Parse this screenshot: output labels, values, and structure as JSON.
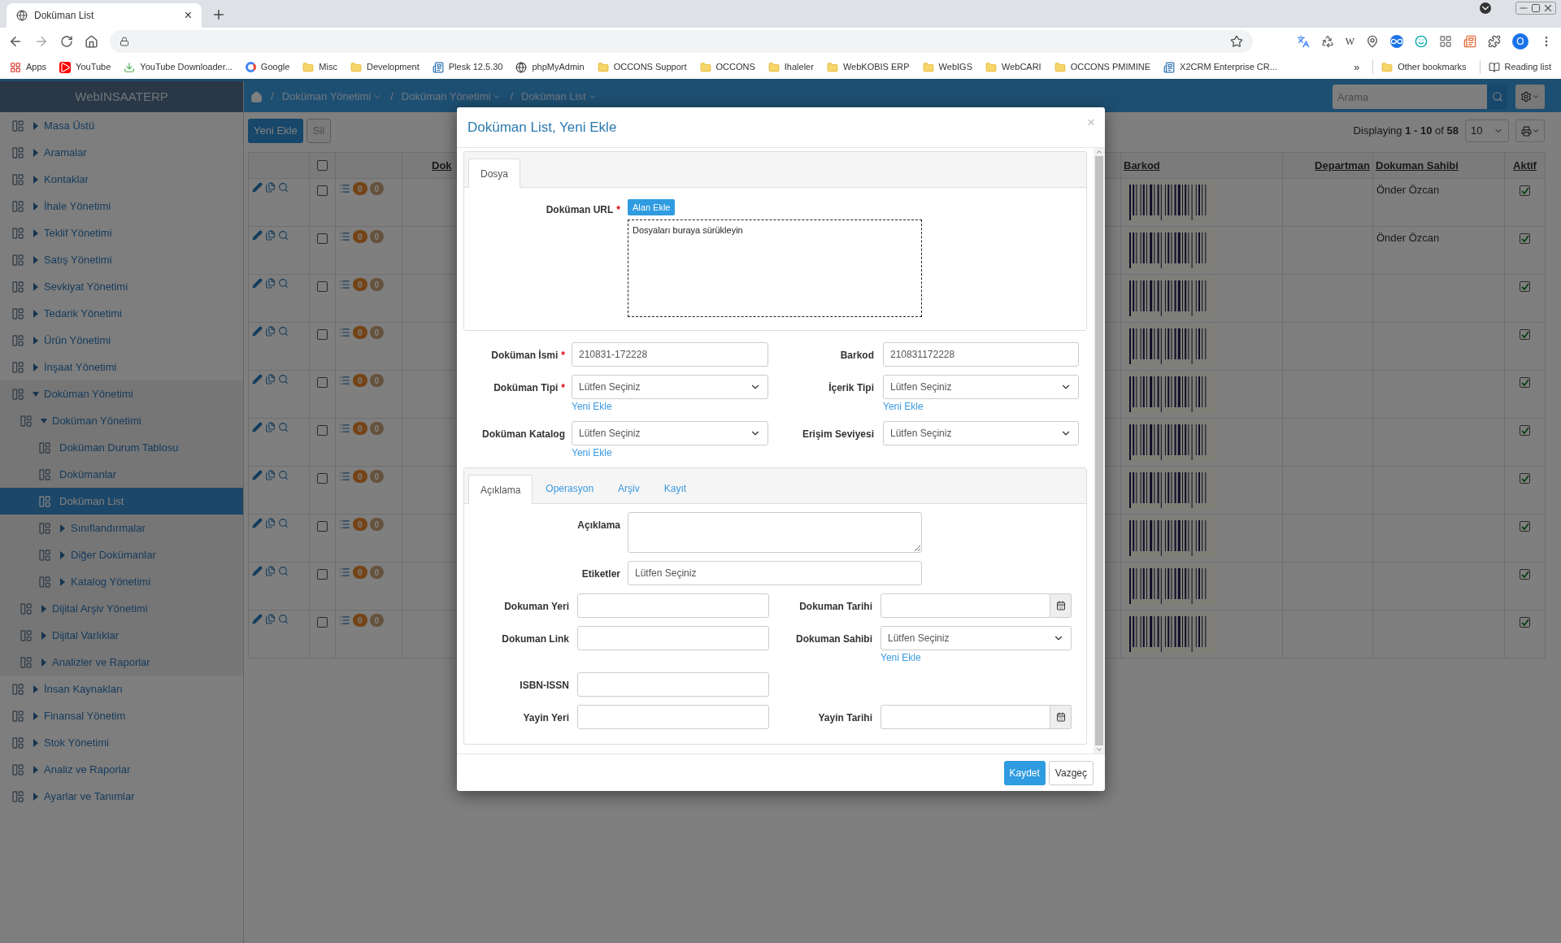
{
  "browser": {
    "tab": {
      "title": "Doküman List",
      "close": "×"
    },
    "extension_letter": "W",
    "profile": "O",
    "bookmarks": [
      {
        "label": "Apps",
        "kind": "apps"
      },
      {
        "label": "YouTube",
        "kind": "video"
      },
      {
        "label": "YouTube Downloader...",
        "kind": "download"
      },
      {
        "label": "Google",
        "kind": "google"
      },
      {
        "label": "Misc",
        "kind": "folder"
      },
      {
        "label": "Development",
        "kind": "folder"
      },
      {
        "label": "Plesk 12.5.30",
        "kind": "site"
      },
      {
        "label": "phpMyAdmin",
        "kind": "globe"
      },
      {
        "label": "OCCONS Support",
        "kind": "folder"
      },
      {
        "label": "OCCONS",
        "kind": "folder"
      },
      {
        "label": "Ihaleler",
        "kind": "folder"
      },
      {
        "label": "WebKOBIS ERP",
        "kind": "folder"
      },
      {
        "label": "WebIGS",
        "kind": "folder"
      },
      {
        "label": "WebCARI",
        "kind": "folder"
      },
      {
        "label": "OCCONS PMIMINE",
        "kind": "folder"
      },
      {
        "label": "X2CRM Enterprise CR...",
        "kind": "site"
      }
    ],
    "overflow": "»",
    "other_bookmarks": "Other bookmarks",
    "reading_list": "Reading list"
  },
  "app": {
    "brand": "WebINSAATERP",
    "breadcrumb": [
      {
        "label": "Doküman Yönetimi"
      },
      {
        "label": "Doküman Yönetimi"
      },
      {
        "label": "Doküman List"
      }
    ],
    "separator": "/",
    "search": {
      "placeholder": "Arama"
    }
  },
  "sidebar": {
    "items": [
      {
        "label": "Masa Üstü",
        "expanded": false,
        "selected": false
      },
      {
        "label": "Aramalar",
        "expanded": false,
        "selected": false
      },
      {
        "label": "Kontaklar",
        "expanded": false,
        "selected": false
      },
      {
        "label": "İhale Yönetimi",
        "expanded": false,
        "selected": false
      },
      {
        "label": "Teklif Yönetimi",
        "expanded": false,
        "selected": false
      },
      {
        "label": "Satış Yönetimi",
        "expanded": false,
        "selected": false
      },
      {
        "label": "Sevkiyat Yönetimi",
        "expanded": false,
        "selected": false
      },
      {
        "label": "Tedarik Yönetimi",
        "expanded": false,
        "selected": false
      },
      {
        "label": "Ürün Yönetimi",
        "expanded": false,
        "selected": false
      },
      {
        "label": "İnşaat Yönetimi",
        "expanded": false,
        "selected": false
      },
      {
        "label": "Doküman Yönetimi",
        "expanded": true,
        "selected": false,
        "children": [
          {
            "label": "Doküman Yönetimi",
            "expanded": true,
            "selected": false,
            "children": [
              {
                "label": "Doküman Durum Tablosu",
                "selected": false
              },
              {
                "label": "Dokümanlar",
                "selected": false
              },
              {
                "label": "Doküman List",
                "selected": true
              },
              {
                "label": "Sınıflandırmalar",
                "expanded": false,
                "selected": false
              },
              {
                "label": "Diğer Dokümanlar",
                "expanded": false,
                "selected": false
              },
              {
                "label": "Katalog Yönetimi",
                "expanded": false,
                "selected": false
              }
            ]
          },
          {
            "label": "Dijital Arşiv Yönetimi",
            "expanded": false,
            "selected": false
          },
          {
            "label": "Dijital Varlıklar",
            "expanded": false,
            "selected": false
          },
          {
            "label": "Analizler ve Raporlar",
            "expanded": false,
            "selected": false
          }
        ]
      },
      {
        "label": "İnsan Kaynakları",
        "expanded": false,
        "selected": false
      },
      {
        "label": "Finansal Yönetim",
        "expanded": false,
        "selected": false
      },
      {
        "label": "Stok Yönetimi",
        "expanded": false,
        "selected": false
      },
      {
        "label": "Analiz ve Raporlar",
        "expanded": false,
        "selected": false
      },
      {
        "label": "Ayarlar ve Tanımlar",
        "expanded": false,
        "selected": false
      }
    ]
  },
  "toolbar": {
    "buttons": [
      {
        "label": "Yeni Ekle",
        "kind": "primary"
      },
      {
        "label": "Sil",
        "kind": "disabled"
      }
    ],
    "paging": "Displaying **1 - 10** of **58**",
    "page_size": "10"
  },
  "table": {
    "select_all": {
      "checked": false
    },
    "columns": [
      {
        "label": "Dok"
      },
      {
        "label": "Barkod"
      },
      {
        "label": "Departman"
      },
      {
        "label": "Dokuman Sahibi"
      },
      {
        "label": "Aktif"
      }
    ],
    "rows": [
      {
        "checked": false,
        "count_1": "0",
        "count_2": "0",
        "owner": "Önder Özcan",
        "aktif": true
      },
      {
        "checked": false,
        "count_1": "0",
        "count_2": "0",
        "owner": "Önder Özcan",
        "aktif": true
      },
      {
        "checked": false,
        "count_1": "0",
        "count_2": "0",
        "aktif": true
      },
      {
        "checked": false,
        "count_1": "0",
        "count_2": "0",
        "aktif": true
      },
      {
        "checked": false,
        "count_1": "0",
        "count_2": "0",
        "aktif": true
      },
      {
        "checked": false,
        "count_1": "0",
        "count_2": "0",
        "aktif": true
      },
      {
        "checked": false,
        "count_1": "0",
        "count_2": "0",
        "aktif": true
      },
      {
        "checked": false,
        "count_1": "0",
        "count_2": "0",
        "aktif": true
      },
      {
        "checked": false,
        "count_1": "0",
        "count_2": "0",
        "aktif": true
      },
      {
        "checked": false,
        "count_1": "0",
        "count_2": "0",
        "aktif": true
      }
    ]
  },
  "modal": {
    "title": "Doküman List, Yeni Ekle",
    "close": "×",
    "file_panel": {
      "tabs": [
        {
          "label": "Dosya",
          "selected": true
        }
      ],
      "url_field": {
        "label": "Doküman URL",
        "required_mark": "*",
        "button": "Alan Ekle",
        "dropzone": "Dosyaları buraya sürükleyin"
      }
    },
    "fields": [
      [
        {
          "label": "Doküman İsmi",
          "required_mark": "*",
          "kind": "text",
          "value": "210831-172228"
        },
        {
          "label": "Barkod",
          "kind": "text",
          "value": "210831172228"
        }
      ],
      [
        {
          "label": "Doküman Tipi",
          "required_mark": "*",
          "kind": "select",
          "value": "Lütfen Seçiniz",
          "add_link": "Yeni Ekle"
        },
        {
          "label": "İçerik Tipi",
          "kind": "select",
          "value": "Lütfen Seçiniz",
          "add_link": "Yeni Ekle"
        }
      ],
      [
        {
          "label": "Doküman Katalog",
          "kind": "select",
          "value": "Lütfen Seçiniz",
          "add_link": "Yeni Ekle"
        },
        {
          "label": "Erişim Seviyesi",
          "kind": "select",
          "value": "Lütfen Seçiniz"
        }
      ]
    ],
    "detail_panel": {
      "tabs": [
        {
          "label": "Açıklama",
          "selected": true
        },
        {
          "label": "Operasyon",
          "selected": false
        },
        {
          "label": "Arşiv",
          "selected": false
        },
        {
          "label": "Kayıt",
          "selected": false
        }
      ],
      "wide_fields": [
        {
          "label": "Açıklama",
          "kind": "textarea"
        },
        {
          "label": "Etiketler",
          "kind": "tags",
          "placeholder": "Lütfen Seçiniz"
        }
      ],
      "fields": [
        [
          {
            "label": "Dokuman Yeri",
            "kind": "text"
          },
          {
            "label": "Dokuman Tarihi",
            "kind": "date"
          }
        ],
        [
          {
            "label": "Dokuman Link",
            "kind": "text"
          },
          {
            "label": "Dokuman Sahibi",
            "kind": "select",
            "value": "Lütfen Seçiniz",
            "add_link": "Yeni Ekle"
          }
        ],
        [
          {
            "label": "ISBN-ISSN",
            "kind": "text"
          }
        ],
        [
          {
            "label": "Yayin Yeri",
            "kind": "text"
          },
          {
            "label": "Yayin Tarihi",
            "kind": "date"
          }
        ]
      ]
    },
    "buttons": [
      {
        "label": "Kaydet",
        "kind": "primary"
      },
      {
        "label": "Vazgeç",
        "kind": "default"
      }
    ]
  }
}
